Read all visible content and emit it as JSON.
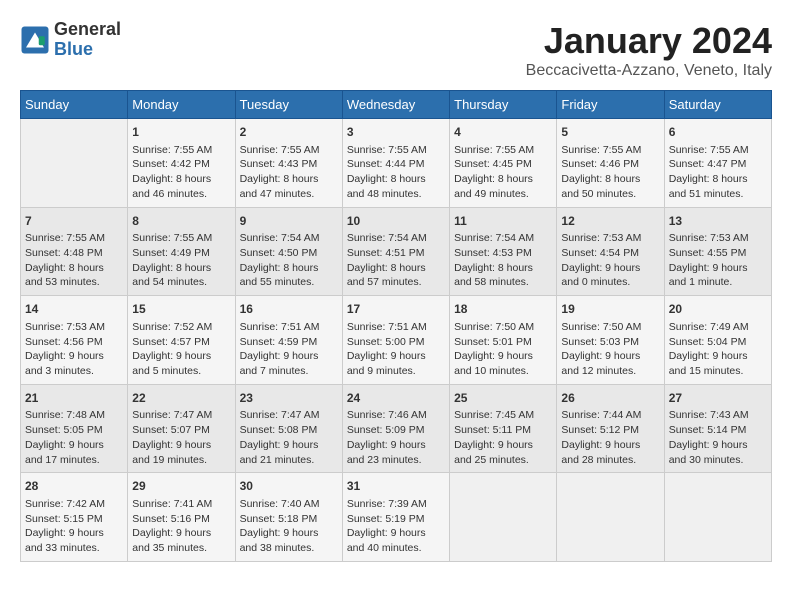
{
  "header": {
    "logo_general": "General",
    "logo_blue": "Blue",
    "month_title": "January 2024",
    "subtitle": "Beccacivetta-Azzano, Veneto, Italy"
  },
  "days_of_week": [
    "Sunday",
    "Monday",
    "Tuesday",
    "Wednesday",
    "Thursday",
    "Friday",
    "Saturday"
  ],
  "weeks": [
    {
      "days": [
        {
          "num": "",
          "content": ""
        },
        {
          "num": "1",
          "content": "Sunrise: 7:55 AM\nSunset: 4:42 PM\nDaylight: 8 hours\nand 46 minutes."
        },
        {
          "num": "2",
          "content": "Sunrise: 7:55 AM\nSunset: 4:43 PM\nDaylight: 8 hours\nand 47 minutes."
        },
        {
          "num": "3",
          "content": "Sunrise: 7:55 AM\nSunset: 4:44 PM\nDaylight: 8 hours\nand 48 minutes."
        },
        {
          "num": "4",
          "content": "Sunrise: 7:55 AM\nSunset: 4:45 PM\nDaylight: 8 hours\nand 49 minutes."
        },
        {
          "num": "5",
          "content": "Sunrise: 7:55 AM\nSunset: 4:46 PM\nDaylight: 8 hours\nand 50 minutes."
        },
        {
          "num": "6",
          "content": "Sunrise: 7:55 AM\nSunset: 4:47 PM\nDaylight: 8 hours\nand 51 minutes."
        }
      ]
    },
    {
      "days": [
        {
          "num": "7",
          "content": "Sunrise: 7:55 AM\nSunset: 4:48 PM\nDaylight: 8 hours\nand 53 minutes."
        },
        {
          "num": "8",
          "content": "Sunrise: 7:55 AM\nSunset: 4:49 PM\nDaylight: 8 hours\nand 54 minutes."
        },
        {
          "num": "9",
          "content": "Sunrise: 7:54 AM\nSunset: 4:50 PM\nDaylight: 8 hours\nand 55 minutes."
        },
        {
          "num": "10",
          "content": "Sunrise: 7:54 AM\nSunset: 4:51 PM\nDaylight: 8 hours\nand 57 minutes."
        },
        {
          "num": "11",
          "content": "Sunrise: 7:54 AM\nSunset: 4:53 PM\nDaylight: 8 hours\nand 58 minutes."
        },
        {
          "num": "12",
          "content": "Sunrise: 7:53 AM\nSunset: 4:54 PM\nDaylight: 9 hours\nand 0 minutes."
        },
        {
          "num": "13",
          "content": "Sunrise: 7:53 AM\nSunset: 4:55 PM\nDaylight: 9 hours\nand 1 minute."
        }
      ]
    },
    {
      "days": [
        {
          "num": "14",
          "content": "Sunrise: 7:53 AM\nSunset: 4:56 PM\nDaylight: 9 hours\nand 3 minutes."
        },
        {
          "num": "15",
          "content": "Sunrise: 7:52 AM\nSunset: 4:57 PM\nDaylight: 9 hours\nand 5 minutes."
        },
        {
          "num": "16",
          "content": "Sunrise: 7:51 AM\nSunset: 4:59 PM\nDaylight: 9 hours\nand 7 minutes."
        },
        {
          "num": "17",
          "content": "Sunrise: 7:51 AM\nSunset: 5:00 PM\nDaylight: 9 hours\nand 9 minutes."
        },
        {
          "num": "18",
          "content": "Sunrise: 7:50 AM\nSunset: 5:01 PM\nDaylight: 9 hours\nand 10 minutes."
        },
        {
          "num": "19",
          "content": "Sunrise: 7:50 AM\nSunset: 5:03 PM\nDaylight: 9 hours\nand 12 minutes."
        },
        {
          "num": "20",
          "content": "Sunrise: 7:49 AM\nSunset: 5:04 PM\nDaylight: 9 hours\nand 15 minutes."
        }
      ]
    },
    {
      "days": [
        {
          "num": "21",
          "content": "Sunrise: 7:48 AM\nSunset: 5:05 PM\nDaylight: 9 hours\nand 17 minutes."
        },
        {
          "num": "22",
          "content": "Sunrise: 7:47 AM\nSunset: 5:07 PM\nDaylight: 9 hours\nand 19 minutes."
        },
        {
          "num": "23",
          "content": "Sunrise: 7:47 AM\nSunset: 5:08 PM\nDaylight: 9 hours\nand 21 minutes."
        },
        {
          "num": "24",
          "content": "Sunrise: 7:46 AM\nSunset: 5:09 PM\nDaylight: 9 hours\nand 23 minutes."
        },
        {
          "num": "25",
          "content": "Sunrise: 7:45 AM\nSunset: 5:11 PM\nDaylight: 9 hours\nand 25 minutes."
        },
        {
          "num": "26",
          "content": "Sunrise: 7:44 AM\nSunset: 5:12 PM\nDaylight: 9 hours\nand 28 minutes."
        },
        {
          "num": "27",
          "content": "Sunrise: 7:43 AM\nSunset: 5:14 PM\nDaylight: 9 hours\nand 30 minutes."
        }
      ]
    },
    {
      "days": [
        {
          "num": "28",
          "content": "Sunrise: 7:42 AM\nSunset: 5:15 PM\nDaylight: 9 hours\nand 33 minutes."
        },
        {
          "num": "29",
          "content": "Sunrise: 7:41 AM\nSunset: 5:16 PM\nDaylight: 9 hours\nand 35 minutes."
        },
        {
          "num": "30",
          "content": "Sunrise: 7:40 AM\nSunset: 5:18 PM\nDaylight: 9 hours\nand 38 minutes."
        },
        {
          "num": "31",
          "content": "Sunrise: 7:39 AM\nSunset: 5:19 PM\nDaylight: 9 hours\nand 40 minutes."
        },
        {
          "num": "",
          "content": ""
        },
        {
          "num": "",
          "content": ""
        },
        {
          "num": "",
          "content": ""
        }
      ]
    }
  ]
}
